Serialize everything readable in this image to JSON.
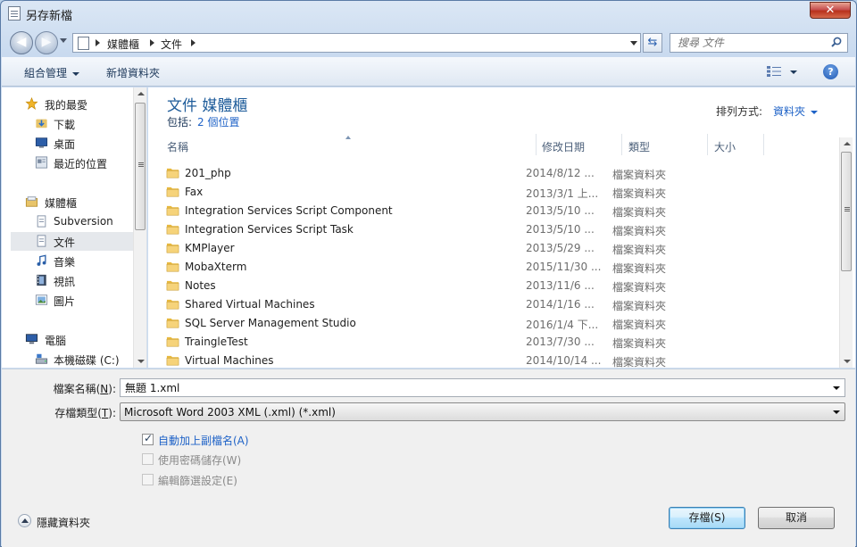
{
  "window": {
    "title": "另存新檔",
    "close_label": "✕"
  },
  "address": {
    "crumbs": [
      "媒體櫃",
      "文件"
    ],
    "search_placeholder": "搜尋 文件"
  },
  "toolbar": {
    "organize_label": "組合管理",
    "new_folder_label": "新增資料夾",
    "help_label": "?"
  },
  "nav": {
    "items": [
      {
        "label": "我的最愛",
        "icon": "star-icon"
      },
      {
        "label": "下載",
        "icon": "download-folder-icon"
      },
      {
        "label": "桌面",
        "icon": "desktop-icon"
      },
      {
        "label": "最近的位置",
        "icon": "recent-places-icon"
      },
      {
        "label": "媒體櫃",
        "icon": "libraries-icon"
      },
      {
        "label": "Subversion",
        "icon": "document-icon"
      },
      {
        "label": "文件",
        "icon": "document-icon",
        "selected": true
      },
      {
        "label": "音樂",
        "icon": "music-icon"
      },
      {
        "label": "視訊",
        "icon": "video-icon"
      },
      {
        "label": "圖片",
        "icon": "pictures-icon"
      },
      {
        "label": "電腦",
        "icon": "computer-icon"
      },
      {
        "label": "本機磁碟 (C:)",
        "icon": "drive-icon"
      }
    ]
  },
  "content": {
    "title": "文件 媒體櫃",
    "includes_label": "包括:",
    "includes_link": "2 個位置",
    "arrange_label": "排列方式:",
    "arrange_value": "資料夾",
    "columns": {
      "name": "名稱",
      "date": "修改日期",
      "type": "類型",
      "size": "大小"
    },
    "rows": [
      {
        "name": "201_php",
        "date": "2014/8/12 ...",
        "type": "檔案資料夾"
      },
      {
        "name": "Fax",
        "date": "2013/3/1 上...",
        "type": "檔案資料夾"
      },
      {
        "name": "Integration Services Script Component",
        "date": "2013/5/10 ...",
        "type": "檔案資料夾"
      },
      {
        "name": "Integration Services Script Task",
        "date": "2013/5/10 ...",
        "type": "檔案資料夾"
      },
      {
        "name": "KMPlayer",
        "date": "2013/5/29 ...",
        "type": "檔案資料夾"
      },
      {
        "name": "MobaXterm",
        "date": "2015/11/30 ...",
        "type": "檔案資料夾"
      },
      {
        "name": "Notes",
        "date": "2013/11/6 ...",
        "type": "檔案資料夾"
      },
      {
        "name": "Shared Virtual Machines",
        "date": "2014/1/16 ...",
        "type": "檔案資料夾"
      },
      {
        "name": "SQL Server Management Studio",
        "date": "2016/1/4 下...",
        "type": "檔案資料夾"
      },
      {
        "name": "TraingleTest",
        "date": "2013/7/30 ...",
        "type": "檔案資料夾"
      },
      {
        "name": "Virtual Machines",
        "date": "2014/10/14 ...",
        "type": "檔案資料夾"
      }
    ]
  },
  "form": {
    "filename_label": "檔案名稱(",
    "filename_key": "N",
    "filename_value": "無題 1.xml",
    "filetype_label": "存檔類型(",
    "filetype_key": "T",
    "filetype_value": "Microsoft Word 2003 XML (.xml) (*.xml)",
    "options": [
      {
        "label": "自動加上副檔名(A)",
        "checked": true,
        "enabled": true
      },
      {
        "label": "使用密碼儲存(W)",
        "checked": false,
        "enabled": false
      },
      {
        "label": "編輯篩選設定(E)",
        "checked": false,
        "enabled": false
      }
    ],
    "hide_folders_label": "隱藏資料夾",
    "save_label": "存檔(S)",
    "cancel_label": "取消"
  }
}
